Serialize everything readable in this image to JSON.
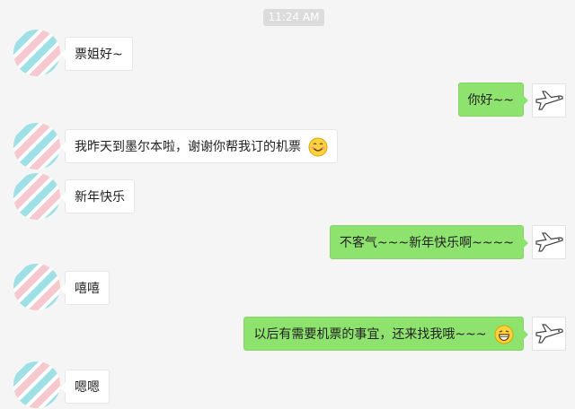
{
  "chat": {
    "timestamp": "11:24 AM",
    "messages": [
      {
        "side": "in",
        "text": "票姐好~"
      },
      {
        "side": "out",
        "text": "你好~~"
      },
      {
        "side": "in",
        "text": "我昨天到墨尔本啦，谢谢你帮我订的机票",
        "emoji": "smile-emoji"
      },
      {
        "side": "in",
        "text": "新年快乐"
      },
      {
        "side": "out",
        "text": "不客气~~~新年快乐啊~~~~"
      },
      {
        "side": "in",
        "text": "嘻嘻"
      },
      {
        "side": "out",
        "text": "以后有需要机票的事宜，还来找我哦~~~",
        "emoji": "grin-emoji"
      },
      {
        "side": "in",
        "text": "嗯嗯"
      }
    ]
  },
  "colors": {
    "background": "#f5f5f5",
    "incoming_bubble": "#ffffff",
    "outgoing_bubble": "#8ee26e",
    "timestamp_bg": "#dcdcdc"
  },
  "icons": {
    "contact_avatar": "striped-avatar-icon",
    "self_avatar": "airplane-icon"
  }
}
